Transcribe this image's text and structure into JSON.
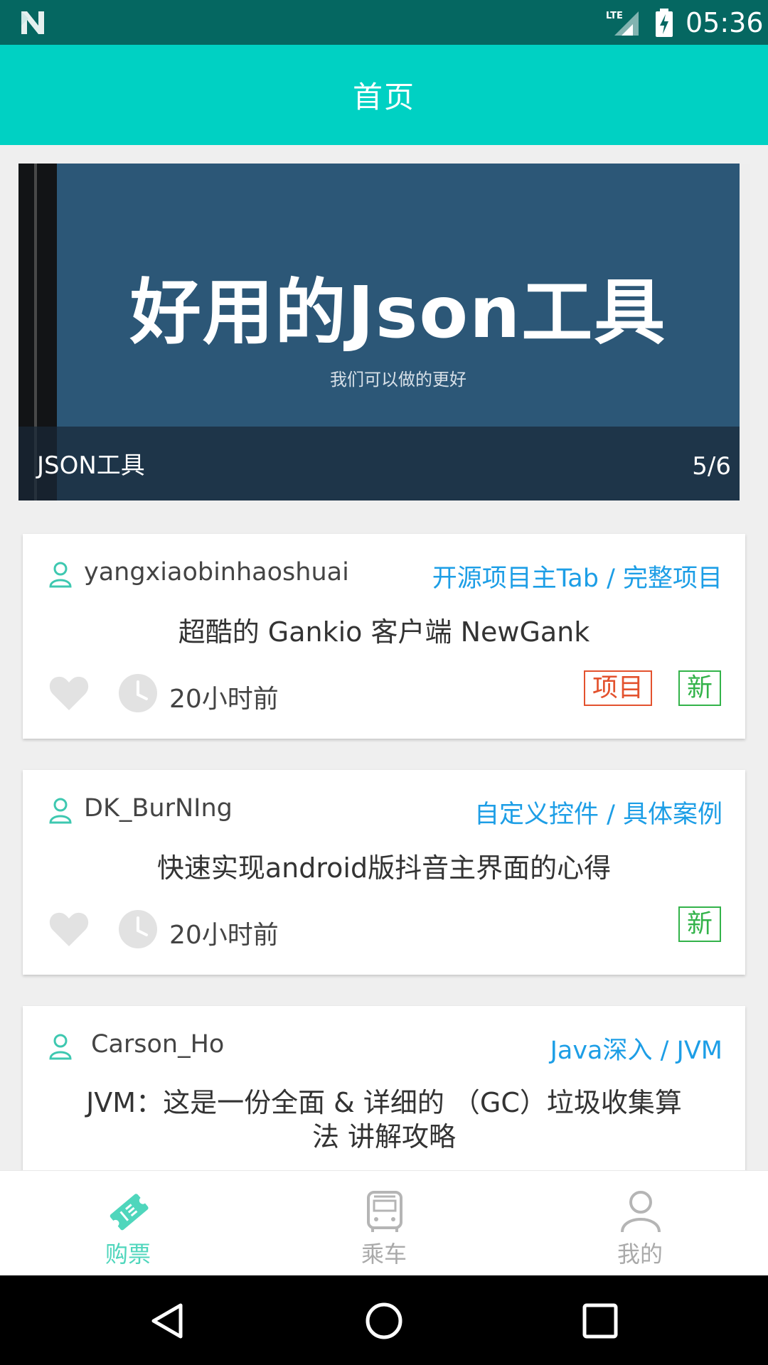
{
  "status_bar": {
    "time": "05:36",
    "network": "LTE"
  },
  "app_bar": {
    "title": "首页"
  },
  "banner": {
    "headline": "好用的Json工具",
    "subtitle": "我们可以做的更好",
    "caption": "JSON工具",
    "counter": "5/6"
  },
  "cards": [
    {
      "author": "yangxiaobinhaoshuai",
      "category": "开源项目主Tab / 完整项目",
      "title": "超酷的 Gankio 客户端 NewGank",
      "time": "20小时前",
      "tags": [
        "项目",
        "新"
      ]
    },
    {
      "author": "DK_BurNIng",
      "category": "自定义控件 / 具体案例",
      "title": "快速实现android版抖音主界面的心得",
      "time": "20小时前",
      "tags": [
        "新"
      ]
    },
    {
      "author": "Carson_Ho",
      "category": "Java深入 / JVM",
      "title_line1": "JVM：这是一份全面 & 详细的 （GC）垃圾收集算",
      "title_line2": "法 讲解攻略"
    }
  ],
  "bottom_nav": {
    "items": [
      {
        "label": "购票",
        "icon": "ticket-icon",
        "active": true
      },
      {
        "label": "乘车",
        "icon": "bus-icon",
        "active": false
      },
      {
        "label": "我的",
        "icon": "person-icon",
        "active": false
      }
    ]
  },
  "colors": {
    "status_bar": "#056761",
    "app_bar": "#00d1c3",
    "category_link": "#1d9ee6",
    "tag_project": "#e3522e",
    "tag_new": "#33b34a",
    "nav_active": "#4fd6bc"
  }
}
